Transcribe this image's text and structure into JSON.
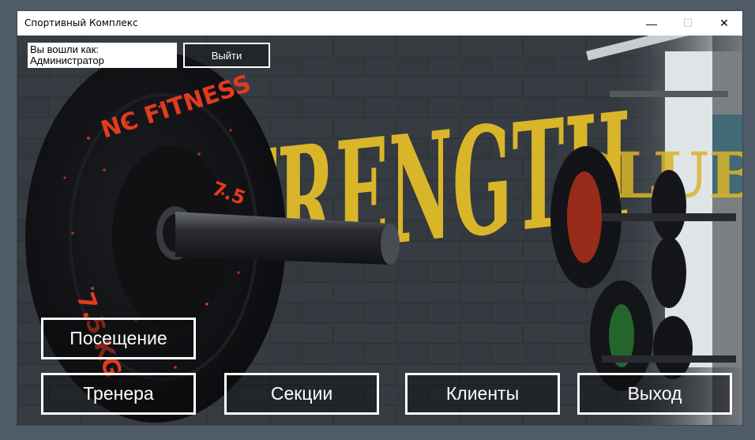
{
  "window": {
    "title": "Спортивный Комплекс",
    "minimize_glyph": "—",
    "maximize_glyph": "☐",
    "close_glyph": "✕"
  },
  "session": {
    "logged_in_as": "Вы вошли как: Администратор",
    "logout_label": "Выйти"
  },
  "background": {
    "wall_text": "STRENGTH CLUB",
    "plate_brand": "NC FITNESS",
    "plate_weight": "7.5 KG"
  },
  "menu": {
    "visits_label": "Посещение",
    "trainers_label": "Тренера",
    "sections_label": "Секции",
    "clients_label": "Клиенты",
    "exit_label": "Выход"
  },
  "colors": {
    "wall": "#2f3439",
    "paint_yellow": "#e8c22a",
    "plate_red": "#e23b1f",
    "button_border": "#ffffff"
  }
}
